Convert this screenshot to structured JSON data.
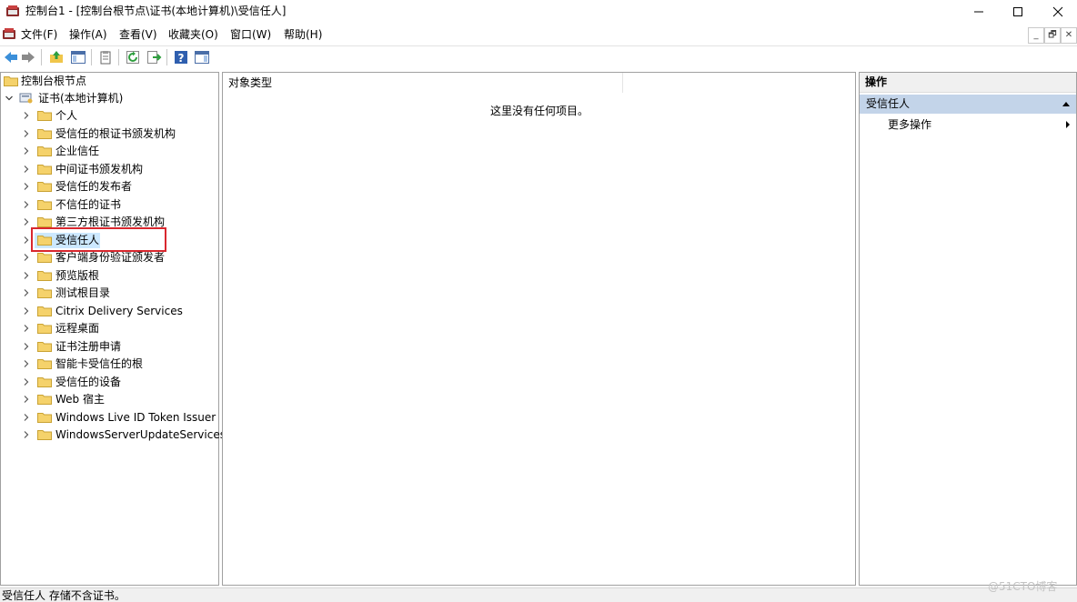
{
  "window": {
    "title": "控制台1 - [控制台根节点\\证书(本地计算机)\\受信任人]",
    "minimize_icon": "minimize-icon",
    "maximize_icon": "maximize-icon",
    "close_icon": "close-icon"
  },
  "menu": {
    "items": [
      "文件(F)",
      "操作(A)",
      "查看(V)",
      "收藏夹(O)",
      "窗口(W)",
      "帮助(H)"
    ],
    "mdi_buttons": [
      "_",
      "🗗",
      "✕"
    ]
  },
  "toolbar": {
    "icons": [
      "back-icon",
      "forward-icon",
      "up-folder-icon",
      "show-hide-console-tree-icon",
      "properties-icon",
      "refresh-icon",
      "export-list-icon",
      "help-icon",
      "show-hide-action-pane-icon"
    ]
  },
  "tree": {
    "root": "控制台根节点",
    "cert_store": "证书(本地计算机)",
    "items": [
      "个人",
      "受信任的根证书颁发机构",
      "企业信任",
      "中间证书颁发机构",
      "受信任的发布者",
      "不信任的证书",
      "第三方根证书颁发机构",
      "受信任人",
      "客户端身份验证颁发者",
      "预览版根",
      "测试根目录",
      "Citrix Delivery Services",
      "远程桌面",
      "证书注册申请",
      "智能卡受信任的根",
      "受信任的设备",
      "Web 宿主",
      "Windows Live ID Token Issuer",
      "WindowsServerUpdateServices"
    ],
    "selected_index": 7
  },
  "center": {
    "column_header": "对象类型",
    "empty_message": "这里没有任何项目。"
  },
  "actions": {
    "title": "操作",
    "section": "受信任人",
    "more": "更多操作"
  },
  "status": {
    "text": "受信任人 存储不含证书。"
  },
  "watermark": "@51CTO博客",
  "colors": {
    "selection": "#cce8ff",
    "actions_section": "#c3d4e9",
    "highlight_box": "#d9272e",
    "folder": "#f5d26b"
  }
}
